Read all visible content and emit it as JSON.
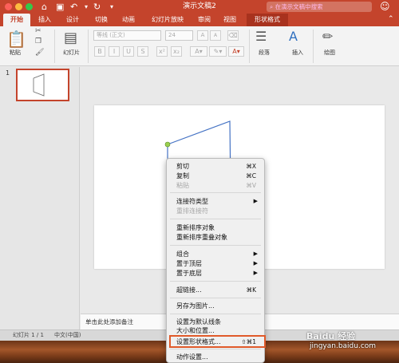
{
  "window": {
    "title": "演示文稿2",
    "search_placeholder": "在演示文稿中搜索",
    "smiley": "☺"
  },
  "tabs": [
    "开始",
    "插入",
    "设计",
    "切换",
    "动画",
    "幻灯片放映",
    "审阅",
    "视图",
    "形状格式"
  ],
  "ribbon": {
    "paste_label": "粘贴",
    "slide_label": "幻灯片",
    "font_name": "等线 (正文)",
    "font_size": "24",
    "paragraph_label": "段落",
    "insert_label": "插入",
    "draw_label": "绘图",
    "bold": "B",
    "italic": "I",
    "underline": "U",
    "grow_font": "A",
    "shrink_font": "A"
  },
  "thumbs": {
    "slide_number": "1"
  },
  "notes": {
    "placeholder": "单击此处添加备注"
  },
  "status": {
    "slide_info": "幻灯片 1 / 1",
    "language": "中文(中国)"
  },
  "watermark": {
    "line1": "Baidu 经验",
    "line2": "jingyan.baidu.com"
  },
  "context_menu": {
    "cut": "剪切",
    "cut_sc": "⌘X",
    "copy": "复制",
    "copy_sc": "⌘C",
    "paste": "粘贴",
    "paste_sc": "⌘V",
    "connector_type": "连接符类型",
    "reroute": "重排连接符",
    "reorder": "重新排序对象",
    "reorder_overlap": "重新排序重叠对象",
    "group": "组合",
    "bring_front": "置于顶层",
    "send_back": "置于底层",
    "hyperlink": "超链接...",
    "hyperlink_sc": "⌘K",
    "save_picture": "另存为图片...",
    "default_line": "设置为默认线条",
    "size_position": "大小和位置...",
    "format_shape": "设置形状格式...",
    "format_shape_sc": "⇧⌘1",
    "action_settings": "动作设置..."
  }
}
